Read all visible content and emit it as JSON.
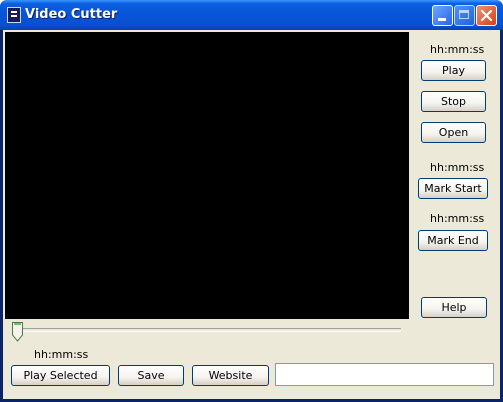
{
  "window": {
    "title": "Video Cutter"
  },
  "controls": {
    "play_time": "hh:mm:ss",
    "play_label": "Play",
    "stop_label": "Stop",
    "open_label": "Open",
    "start_time": "hh:mm:ss",
    "mark_start_label": "Mark Start",
    "end_time": "hh:mm:ss",
    "mark_end_label": "Mark End",
    "help_label": "Help"
  },
  "bottom": {
    "position_time": "hh:mm:ss",
    "play_selected_label": "Play Selected",
    "save_label": "Save",
    "website_label": "Website",
    "status_value": ""
  },
  "seek": {
    "position_fraction": 0.0
  }
}
